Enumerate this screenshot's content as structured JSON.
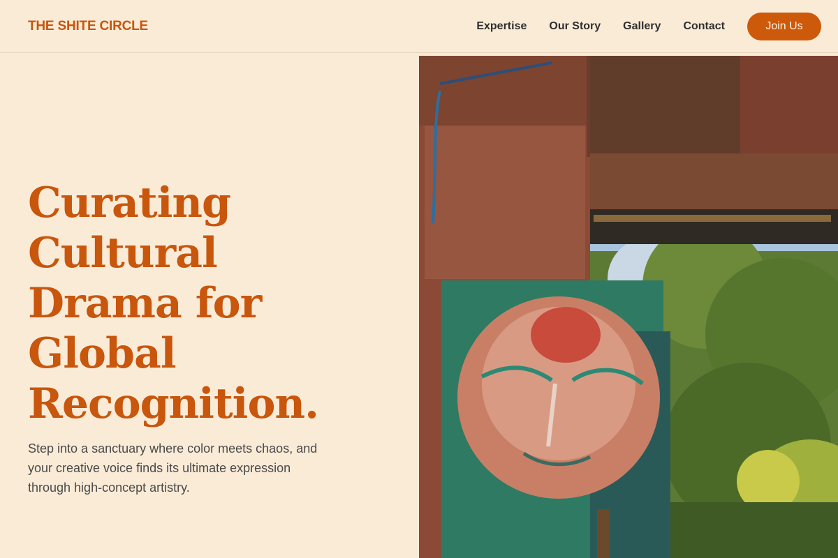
{
  "brand": {
    "name": "THE SHITE CIRCLE"
  },
  "nav": {
    "items": [
      {
        "label": "Expertise"
      },
      {
        "label": "Our Story"
      },
      {
        "label": "Gallery"
      },
      {
        "label": "Contact"
      }
    ],
    "cta_label": "Join Us"
  },
  "hero": {
    "title": "Curating Cultural Drama for Global Recognition.",
    "subtitle": "Step into a sanctuary where color meets chaos, and your creative voice finds its ultimate expression through high-concept artistry."
  },
  "colors": {
    "background": "#faebd7",
    "accent": "#c8560c",
    "button": "#cc5a0a",
    "text": "#2f2f2f"
  }
}
